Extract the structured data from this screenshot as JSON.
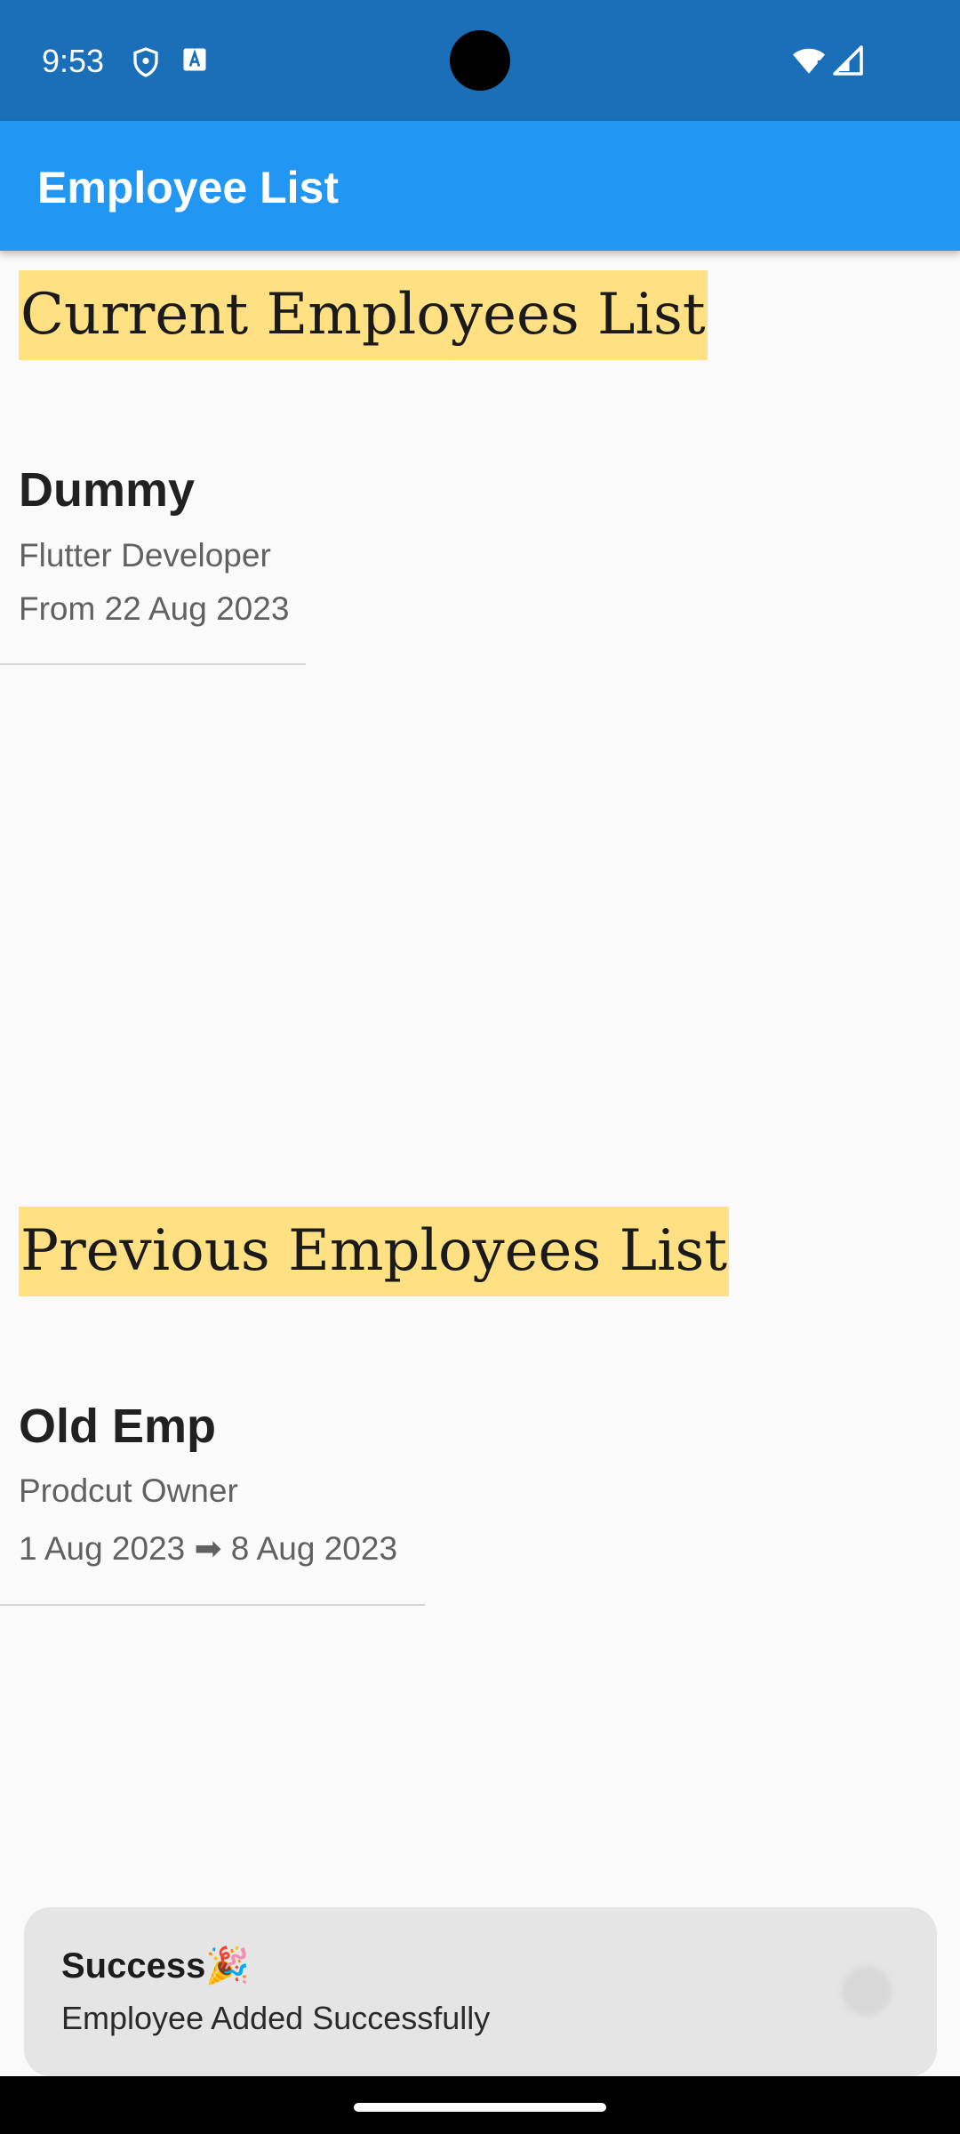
{
  "status_bar": {
    "time": "9:53",
    "icons": [
      "shield-icon",
      "text-a-icon",
      "wifi-icon",
      "signal-icon"
    ]
  },
  "app_bar": {
    "title": "Employee List",
    "color": "#2196f3"
  },
  "current_section": {
    "heading": "Current Employees List",
    "employees": [
      {
        "name": "Dummy",
        "role": "Flutter Developer",
        "dates": "From 22 Aug 2023"
      }
    ]
  },
  "previous_section": {
    "heading": "Previous Employees List",
    "employees": [
      {
        "name": "Old Emp",
        "role": "Prodcut Owner",
        "dates": "1 Aug 2023 ➡ 8 Aug 2023"
      }
    ]
  },
  "snackbar": {
    "title": "Success🎉",
    "message": "Employee Added Successfully"
  },
  "colors": {
    "status_bar": "#1b6fb8",
    "heading_highlight": "#ffe082"
  }
}
